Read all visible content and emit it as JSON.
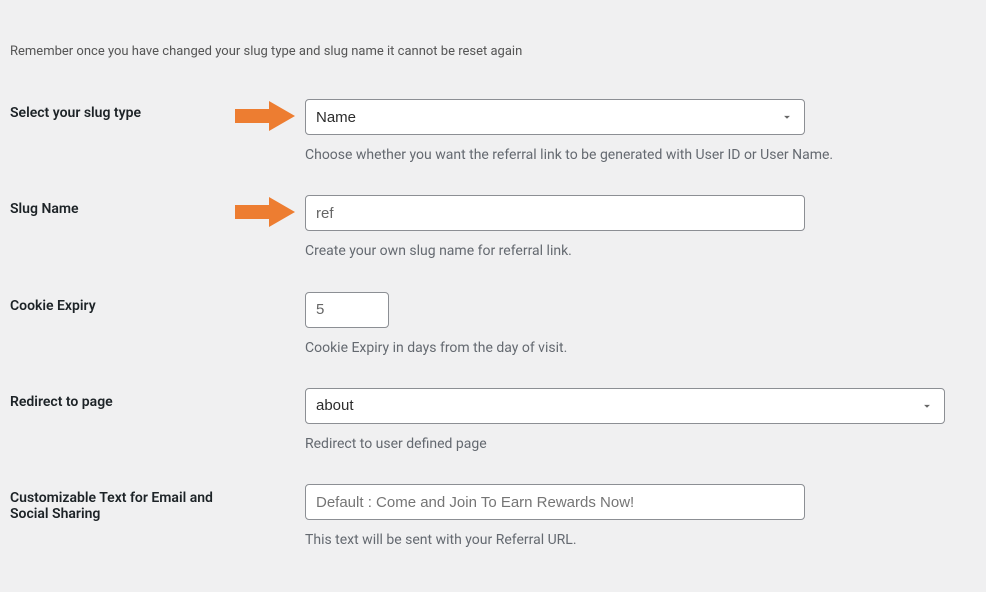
{
  "notice": "Remember once you have changed your slug type and slug name it cannot be reset again",
  "slug_type": {
    "label": "Select your slug type",
    "value": "Name",
    "description": "Choose whether you want the referral link to be generated with User ID or User Name."
  },
  "slug_name": {
    "label": "Slug Name",
    "value": "ref",
    "description": "Create your own slug name for referral link."
  },
  "cookie_expiry": {
    "label": "Cookie Expiry",
    "value": "5",
    "description": "Cookie Expiry in days from the day of visit."
  },
  "redirect": {
    "label": "Redirect to page",
    "value": "about",
    "description": "Redirect to user defined page"
  },
  "custom_text": {
    "label": "Customizable Text for Email and Social Sharing",
    "placeholder": "Default : Come and Join To Earn Rewards Now!",
    "description": "This text will be sent with your Referral URL."
  },
  "colors": {
    "arrow": "#ed7d31"
  }
}
